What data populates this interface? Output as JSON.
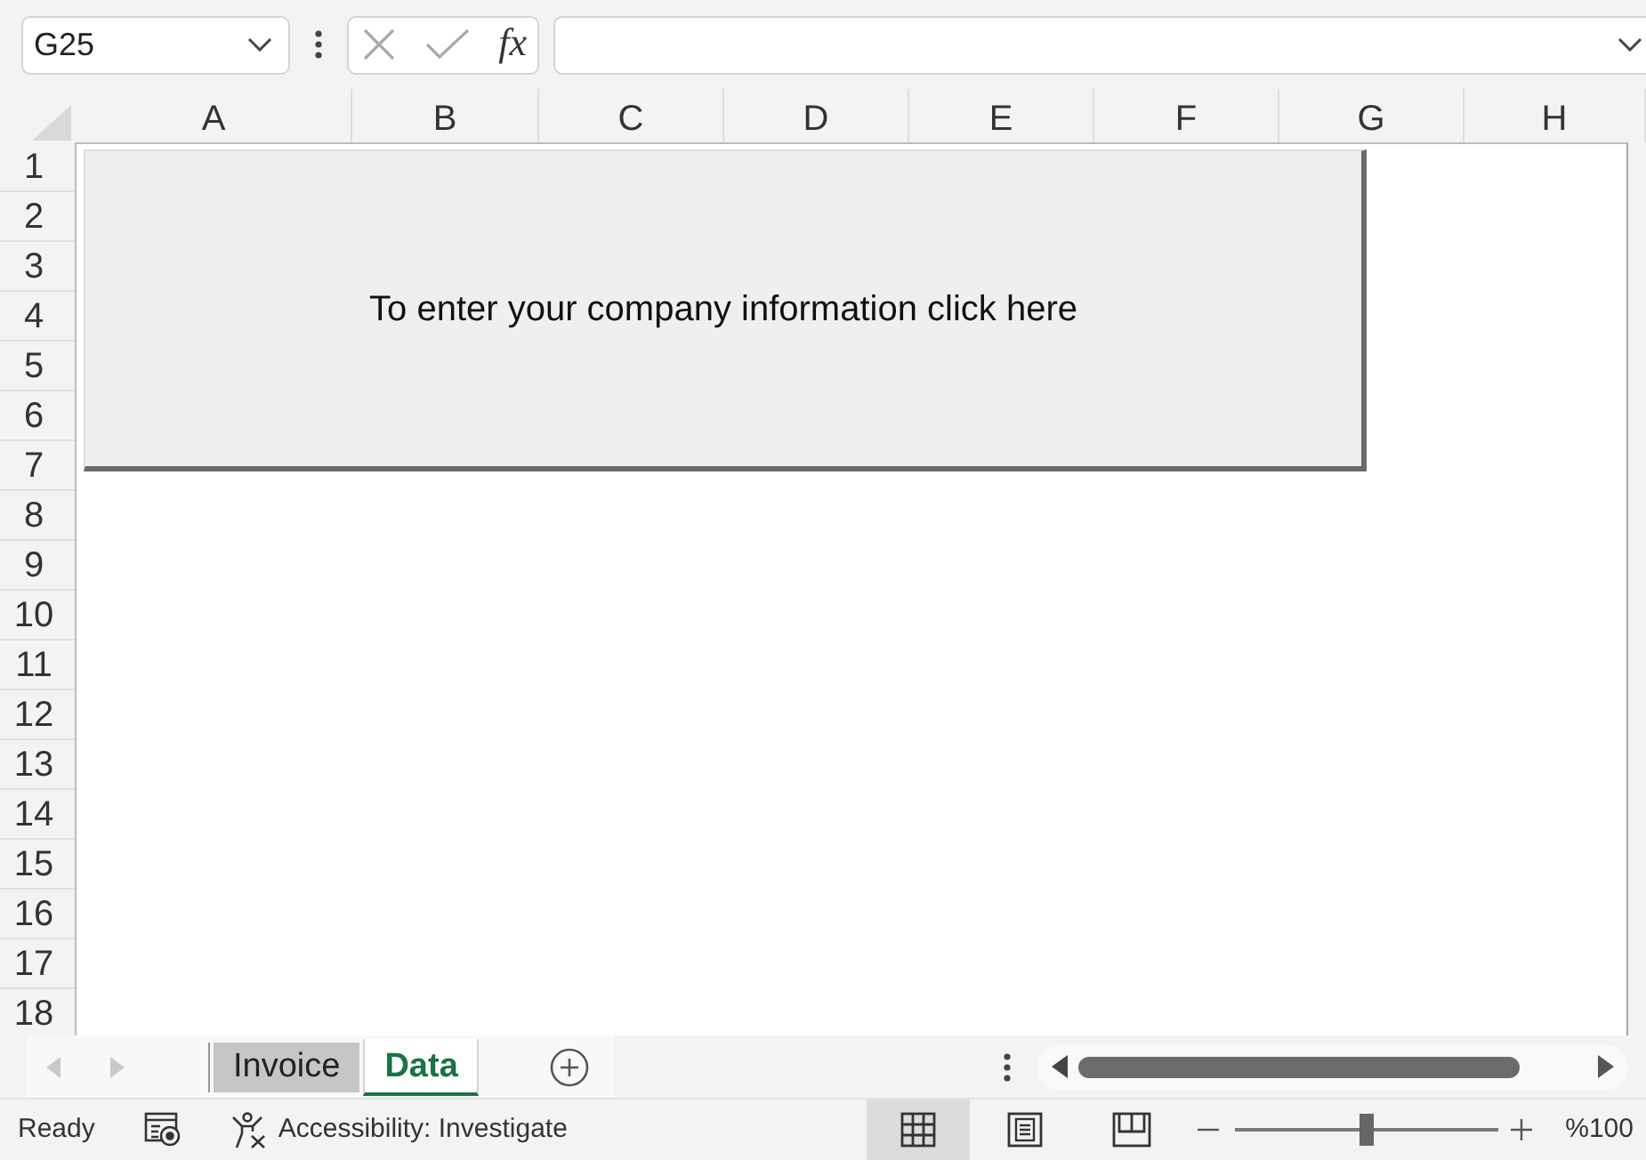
{
  "name_box": {
    "value": "G25"
  },
  "formula_bar": {
    "function_label": "fx"
  },
  "columns": [
    "A",
    "B",
    "C",
    "D",
    "E",
    "F",
    "G",
    "H"
  ],
  "rows": [
    "1",
    "2",
    "3",
    "4",
    "5",
    "6",
    "7",
    "8",
    "9",
    "10",
    "11",
    "12",
    "13",
    "14",
    "15",
    "16",
    "17",
    "18"
  ],
  "shape_button": {
    "label": "To enter your company information click here"
  },
  "sheet_tabs": [
    {
      "label": "Invoice",
      "selected": false
    },
    {
      "label": "Data",
      "selected": true
    }
  ],
  "status_bar": {
    "mode": "Ready",
    "accessibility": "Accessibility: Investigate",
    "views": [
      {
        "kind": "normal",
        "selected": true
      },
      {
        "kind": "page_layout",
        "selected": false
      },
      {
        "kind": "page_break",
        "selected": false
      }
    ],
    "zoom": {
      "level": 0.5,
      "reading": "%100"
    }
  }
}
